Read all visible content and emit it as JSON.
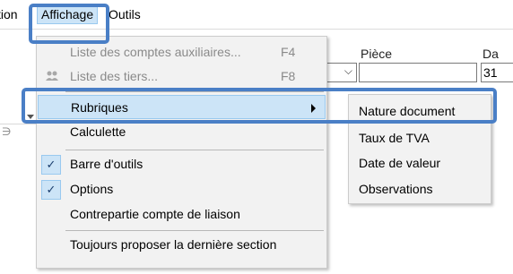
{
  "menubar": {
    "partial_item": "tion",
    "affichage": "Affichage",
    "outils": "Outils"
  },
  "background": {
    "piece_label": "Pièce",
    "date_label_partial": "Da",
    "date_value_partial": "31"
  },
  "menu": {
    "items": [
      {
        "label": "Liste des comptes  auxiliaires...",
        "shortcut": "F4",
        "enabled": false
      },
      {
        "label": "Liste des tiers...",
        "shortcut": "F8",
        "enabled": false,
        "icon": "users-icon"
      },
      {
        "label": "Rubriques",
        "has_submenu": true,
        "selected": true
      },
      {
        "label": "Calculette"
      },
      {
        "label": "Barre d'outils",
        "checked": true
      },
      {
        "label": "Options",
        "checked": true
      },
      {
        "label": "Contrepartie compte de liaison"
      },
      {
        "label": "Toujours proposer la dernière section"
      }
    ],
    "check_glyph": "✓"
  },
  "submenu": {
    "items": [
      {
        "label": "Nature document"
      },
      {
        "label": "Taux de TVA"
      },
      {
        "label": "Date de valeur"
      },
      {
        "label": "Observations"
      }
    ]
  },
  "colors": {
    "highlight_outline": "#4a7fc6",
    "selection_bg": "#cce4f7",
    "selection_border": "#99c9ef",
    "menu_bg": "#f2f2f2",
    "disabled_text": "#8a8a8a"
  }
}
